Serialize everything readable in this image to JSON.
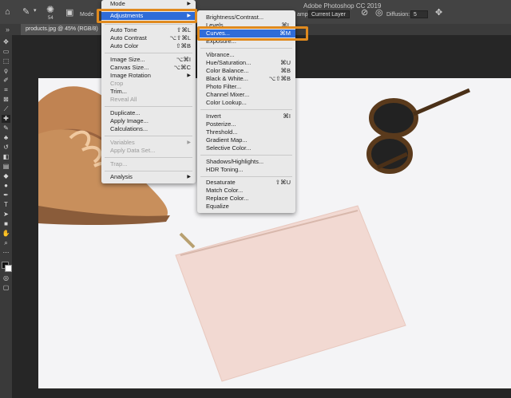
{
  "app": {
    "title": "Adobe Photoshop CC 2019"
  },
  "options_bar": {
    "mode_label": "Mode",
    "brush_size": "54",
    "sample_label": "ample:",
    "sample_value": "Current Layer",
    "diffusion_label": "Diffusion:",
    "diffusion_value": "5"
  },
  "document_tab": {
    "label": "products.jpg @ 45% (RGB/8) *"
  },
  "image_menu": {
    "items": [
      {
        "label": "Mode",
        "shortcut": "",
        "arrow": true,
        "disabled": false
      },
      {
        "label": "Adjustments",
        "shortcut": "",
        "arrow": true,
        "disabled": false,
        "highlighted": true
      },
      {
        "label": "Auto Tone",
        "shortcut": "⇧⌘L",
        "arrow": false,
        "disabled": false
      },
      {
        "label": "Auto Contrast",
        "shortcut": "⌥⇧⌘L",
        "arrow": false,
        "disabled": false
      },
      {
        "label": "Auto Color",
        "shortcut": "⇧⌘B",
        "arrow": false,
        "disabled": false
      },
      {
        "label": "Image Size...",
        "shortcut": "⌥⌘I",
        "arrow": false,
        "disabled": false
      },
      {
        "label": "Canvas Size...",
        "shortcut": "⌥⌘C",
        "arrow": false,
        "disabled": false
      },
      {
        "label": "Image Rotation",
        "shortcut": "",
        "arrow": true,
        "disabled": false
      },
      {
        "label": "Crop",
        "shortcut": "",
        "arrow": false,
        "disabled": true
      },
      {
        "label": "Trim...",
        "shortcut": "",
        "arrow": false,
        "disabled": false
      },
      {
        "label": "Reveal All",
        "shortcut": "",
        "arrow": false,
        "disabled": true
      },
      {
        "label": "Duplicate...",
        "shortcut": "",
        "arrow": false,
        "disabled": false
      },
      {
        "label": "Apply Image...",
        "shortcut": "",
        "arrow": false,
        "disabled": false
      },
      {
        "label": "Calculations...",
        "shortcut": "",
        "arrow": false,
        "disabled": false
      },
      {
        "label": "Variables",
        "shortcut": "",
        "arrow": true,
        "disabled": true
      },
      {
        "label": "Apply Data Set...",
        "shortcut": "",
        "arrow": false,
        "disabled": true
      },
      {
        "label": "Trap...",
        "shortcut": "",
        "arrow": false,
        "disabled": true
      },
      {
        "label": "Analysis",
        "shortcut": "",
        "arrow": true,
        "disabled": false
      }
    ]
  },
  "adjustments_menu": {
    "items": [
      {
        "label": "Brightness/Contrast...",
        "shortcut": ""
      },
      {
        "label": "Levels...",
        "shortcut": "⌘L"
      },
      {
        "label": "Curves...",
        "shortcut": "⌘M",
        "highlighted": true
      },
      {
        "label": "Exposure...",
        "shortcut": ""
      },
      {
        "label": "Vibrance...",
        "shortcut": ""
      },
      {
        "label": "Hue/Saturation...",
        "shortcut": "⌘U"
      },
      {
        "label": "Color Balance...",
        "shortcut": "⌘B"
      },
      {
        "label": "Black & White...",
        "shortcut": "⌥⇧⌘B"
      },
      {
        "label": "Photo Filter...",
        "shortcut": ""
      },
      {
        "label": "Channel Mixer...",
        "shortcut": ""
      },
      {
        "label": "Color Lookup...",
        "shortcut": ""
      },
      {
        "label": "Invert",
        "shortcut": "⌘I"
      },
      {
        "label": "Posterize...",
        "shortcut": ""
      },
      {
        "label": "Threshold...",
        "shortcut": ""
      },
      {
        "label": "Gradient Map...",
        "shortcut": ""
      },
      {
        "label": "Selective Color...",
        "shortcut": ""
      },
      {
        "label": "Shadows/Highlights...",
        "shortcut": ""
      },
      {
        "label": "HDR Toning...",
        "shortcut": ""
      },
      {
        "label": "Desaturate",
        "shortcut": "⇧⌘U"
      },
      {
        "label": "Match Color...",
        "shortcut": ""
      },
      {
        "label": "Replace Color...",
        "shortcut": ""
      },
      {
        "label": "Equalize",
        "shortcut": ""
      }
    ]
  },
  "tools": [
    "move-tool",
    "artboard-tool",
    "marquee-tool",
    "lasso-tool",
    "quick-select-tool",
    "crop-tool",
    "frame-tool",
    "eyedropper-tool",
    "healing-brush-tool",
    "brush-tool",
    "clone-stamp-tool",
    "history-brush-tool",
    "eraser-tool",
    "gradient-tool",
    "blur-tool",
    "dodge-tool",
    "pen-tool",
    "type-tool",
    "path-select-tool",
    "rectangle-tool",
    "hand-tool",
    "zoom-tool"
  ],
  "colors": {
    "highlight": "#2f6cd8",
    "callout": "#e08a1e",
    "pouch": "#f2d9d2"
  }
}
